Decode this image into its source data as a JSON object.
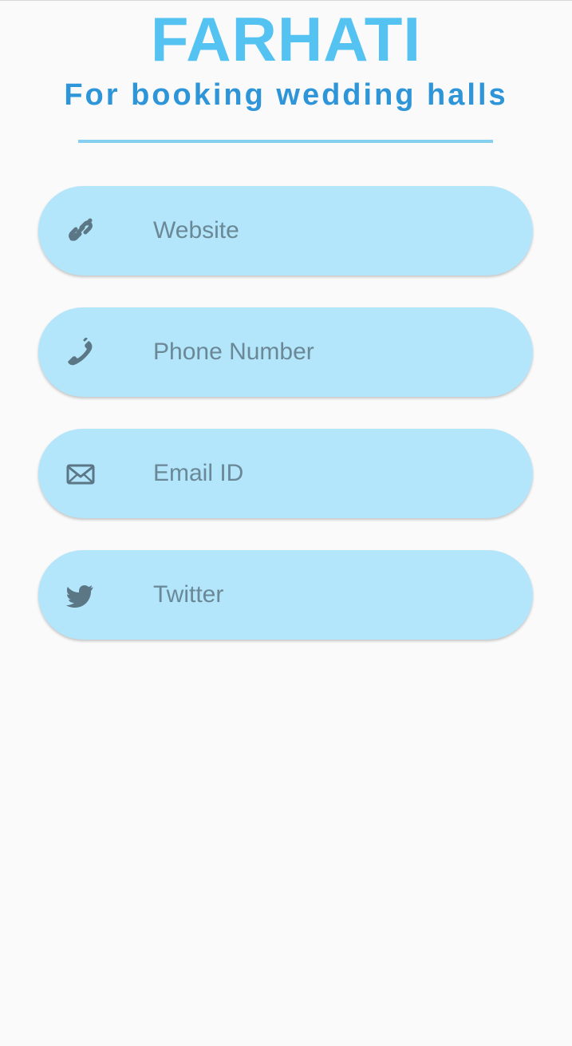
{
  "header": {
    "title": "FARHATI",
    "subtitle": "For booking wedding halls"
  },
  "form": {
    "fields": [
      {
        "placeholder": "Website",
        "value": "",
        "icon": "link-icon"
      },
      {
        "placeholder": "Phone Number",
        "value": "",
        "icon": "phone-icon"
      },
      {
        "placeholder": "Email ID",
        "value": "",
        "icon": "envelope-icon"
      },
      {
        "placeholder": "Twitter",
        "value": "",
        "icon": "twitter-icon"
      }
    ]
  },
  "colors": {
    "title": "#55c3f2",
    "subtitle": "#2e95d9",
    "divider": "#87cfee",
    "field_background": "#b3e5fb",
    "icon_and_placeholder": "#6a8896",
    "page_background": "#fafafa"
  }
}
